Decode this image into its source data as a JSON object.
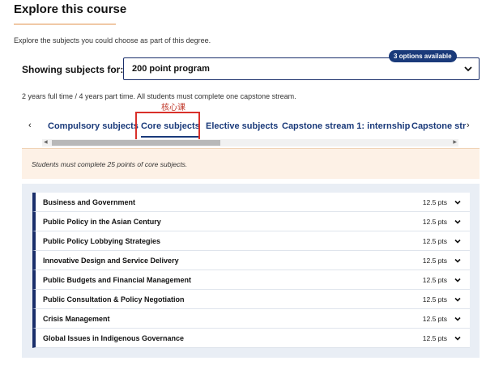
{
  "page": {
    "title": "Explore this course",
    "intro": "Explore the subjects you could choose as part of this degree.",
    "showing_label": "Showing subjects for:",
    "program_select": {
      "value": "200 point program",
      "badge": "3 options available"
    },
    "study_note": "2 years full time / 4 years part time. All students must complete one capstone stream.",
    "annotation": "核心课"
  },
  "tabs": [
    {
      "label": "Compulsory subjects"
    },
    {
      "label": "Core subjects",
      "active": true
    },
    {
      "label": "Elective subjects"
    },
    {
      "label": "Capstone stream 1: internship"
    },
    {
      "label": "Capstone str"
    }
  ],
  "notice": "Students must complete 25 points of core subjects.",
  "subjects": [
    {
      "name": "Business and Government",
      "points": "12.5 pts"
    },
    {
      "name": "Public Policy in the Asian Century",
      "points": "12.5 pts"
    },
    {
      "name": "Public Policy Lobbying Strategies",
      "points": "12.5 pts"
    },
    {
      "name": "Innovative Design and Service Delivery",
      "points": "12.5 pts"
    },
    {
      "name": "Public Budgets and Financial Management",
      "points": "12.5 pts"
    },
    {
      "name": "Public Consultation & Policy Negotiation",
      "points": "12.5 pts"
    },
    {
      "name": "Crisis Management",
      "points": "12.5 pts"
    },
    {
      "name": "Global Issues in Indigenous Governance",
      "points": "12.5 pts"
    }
  ],
  "colors": {
    "brand": "#1a3a7a",
    "highlight": "#d9302a",
    "notice_bg": "#fdf1e6"
  },
  "icons": {
    "select": "chevron-down-icon",
    "row": "chevron-down-icon",
    "tabs_prev": "chevron-left-icon",
    "tabs_next": "chevron-right-icon"
  }
}
